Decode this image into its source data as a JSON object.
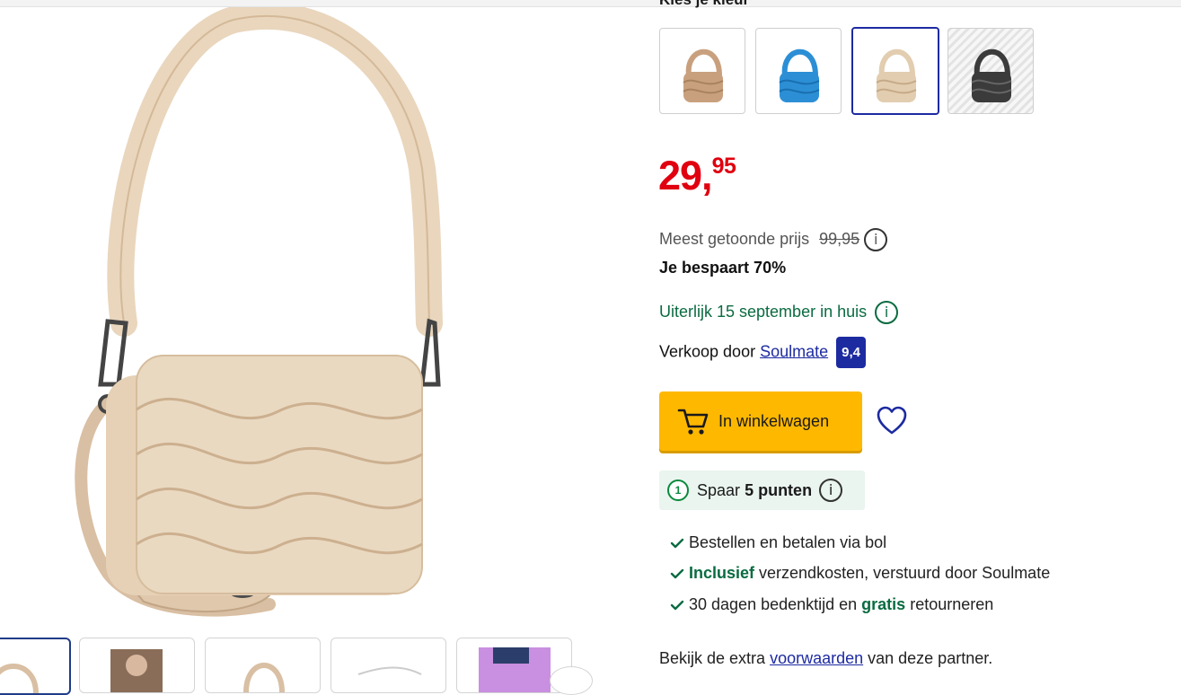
{
  "colors": {
    "price_red": "#e0000f",
    "bol_blue": "#1d2ba1",
    "cta_yellow": "#ffb800",
    "delivery_green": "#0a6b41"
  },
  "gallery": {
    "main_image_icon": "quilted-beige-shoulder-bag-photo",
    "thumbnails": [
      "bag-thumb-1",
      "bag-thumb-2",
      "bag-thumb-3",
      "bag-thumb-4",
      "bag-thumb-5"
    ],
    "next_icon": "chevron-right-icon"
  },
  "variants": {
    "label": "Kies je kleur",
    "swatches": [
      {
        "icon": "camel-bag-swatch",
        "color": "#c9a07e"
      },
      {
        "icon": "blue-bag-swatch",
        "color": "#2c8fd6"
      },
      {
        "icon": "beige-bag-swatch",
        "color": "#e2cdb0"
      },
      {
        "icon": "black-bag-swatch",
        "color": "#3b3b3b"
      }
    ]
  },
  "price": {
    "euros": "29,",
    "cents": "95"
  },
  "reference": {
    "label": "Meest getoonde prijs",
    "old_price": "99,95",
    "info": "i",
    "saving": "Je bespaart 70%"
  },
  "delivery": {
    "text": "Uiterlijk 15 september in huis",
    "info": "i"
  },
  "seller": {
    "prefix": "Verkoop door",
    "name": "Soulmate",
    "score": "9,4"
  },
  "cart": {
    "label": "In winkelwagen",
    "icon": "cart-icon"
  },
  "wishlist": {
    "icon": "heart-icon"
  },
  "points": {
    "prefix": "Spaar",
    "bold": "5 punten",
    "info": "i",
    "icon": "piggy-bank-icon"
  },
  "usps": [
    {
      "bold": "",
      "text": "Bestellen en betalen via bol"
    },
    {
      "bold": "Inclusief",
      "text": " verzendkosten, verstuurd door Soulmate"
    },
    {
      "pre": "30 dagen bedenktijd en ",
      "bold": "gratis",
      "post": " retourneren"
    }
  ],
  "footer": {
    "pre": "Bekijk de extra ",
    "link": "voorwaarden",
    "post": " van deze partner."
  }
}
